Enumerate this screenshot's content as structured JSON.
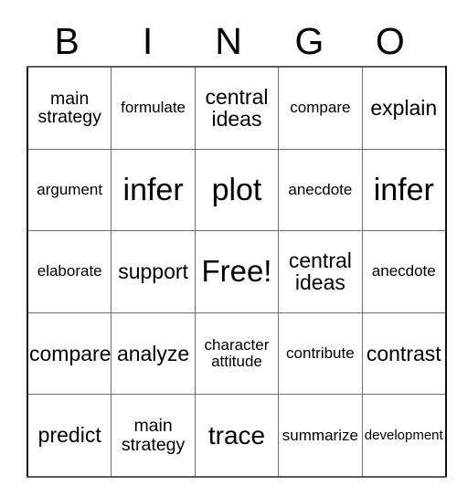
{
  "card": {
    "title_letters": [
      "B",
      "I",
      "N",
      "G",
      "O"
    ],
    "free_space_label": "Free!",
    "rows": [
      [
        {
          "text": "main\nstrategy",
          "size": "m"
        },
        {
          "text": "formulate",
          "size": "s"
        },
        {
          "text": "central\nideas",
          "size": "l"
        },
        {
          "text": "compare",
          "size": "s"
        },
        {
          "text": "explain",
          "size": "l"
        }
      ],
      [
        {
          "text": "argument",
          "size": "s"
        },
        {
          "text": "infer",
          "size": "xxl"
        },
        {
          "text": "plot",
          "size": "xxl"
        },
        {
          "text": "anecdote",
          "size": "s"
        },
        {
          "text": "infer",
          "size": "xxl"
        }
      ],
      [
        {
          "text": "elaborate",
          "size": "s"
        },
        {
          "text": "support",
          "size": "l"
        },
        {
          "text": "Free!",
          "size": "free"
        },
        {
          "text": "central\nideas",
          "size": "l"
        },
        {
          "text": "anecdote",
          "size": "s"
        }
      ],
      [
        {
          "text": "compare",
          "size": "l"
        },
        {
          "text": "analyze",
          "size": "l"
        },
        {
          "text": "character\nattitude",
          "size": "s"
        },
        {
          "text": "contribute",
          "size": "s"
        },
        {
          "text": "contrast",
          "size": "l"
        }
      ],
      [
        {
          "text": "predict",
          "size": "l"
        },
        {
          "text": "main\nstrategy",
          "size": "m"
        },
        {
          "text": "trace",
          "size": "xl"
        },
        {
          "text": "summarize",
          "size": "s"
        },
        {
          "text": "development",
          "size": "xs"
        }
      ]
    ]
  }
}
